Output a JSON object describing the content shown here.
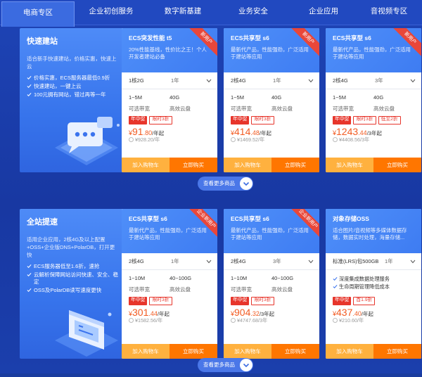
{
  "tabs": [
    "电商专区",
    "企业初创服务",
    "数字新基建",
    "业务安全",
    "企业应用",
    "音视频专区"
  ],
  "row1": {
    "promo": {
      "title": "快速建站",
      "desc": "适合新手快速建站，价格实惠，快速上云",
      "items": [
        "价格实惠，ECS服务器最低0.9折",
        "快速建站，一键上云",
        "100元拥有网站，错过再等一年"
      ]
    },
    "cards": [
      {
        "title": "ECS突发性能 t5",
        "desc": "20%性能基线，性价比之王！个人开发者建站必备",
        "ribbon": "新用户",
        "spec1": "1核2G",
        "spec2": "1年",
        "cpu": "1~5M",
        "cpu_sub": "可选带宽",
        "disk": "40G",
        "disk_sub": "高效云盘",
        "tag1": "年中促",
        "tag2": "限时3折",
        "currency": "¥",
        "price_int": "91",
        "price_dec": ".80",
        "unit": "/年起",
        "orig": "¥928.20/年",
        "btn_cart": "加入购物车",
        "btn_buy": "立即购买"
      },
      {
        "title": "ECS共享型 s6",
        "desc": "最新代产品，性能强劲，广泛适用于建站等应用",
        "ribbon": "新用户",
        "spec1": "2核4G",
        "spec2": "1年",
        "cpu": "1~5M",
        "cpu_sub": "可选带宽",
        "disk": "40G",
        "disk_sub": "高效云盘",
        "tag1": "年中促",
        "tag2": "限时3折",
        "currency": "¥",
        "price_int": "414",
        "price_dec": ".48",
        "unit": "/年起",
        "orig": "¥1469.52/年",
        "btn_cart": "加入购物车",
        "btn_buy": "立即购买"
      },
      {
        "title": "ECS共享型 s6",
        "desc": "最新代产品，性能强劲，广泛适用于建站等应用",
        "ribbon": "新用户",
        "spec1": "2核4G",
        "spec2": "3年",
        "cpu": "1~5M",
        "cpu_sub": "可选带宽",
        "disk": "40G",
        "disk_sub": "高效云盘",
        "tag1": "年中促",
        "tag2": "限时3折",
        "tag3": "低至2折",
        "currency": "¥",
        "price_int": "1243",
        "price_dec": ".44",
        "unit": "/3年起",
        "orig": "¥4408.56/3年",
        "btn_cart": "加入购物车",
        "btn_buy": "立即购买"
      }
    ],
    "more_label": "查看更多商品"
  },
  "row2": {
    "promo": {
      "title": "全站提速",
      "desc": "适用企业应用，2核4G及以上配置+OSS+企业版DNS+PolarDB，打开更快",
      "items": [
        "ECS服务器低至1.6折，速抢",
        "云解析保障网站访问快速、安全、稳定",
        "OSS及PolarDB读写速度更快"
      ]
    },
    "cards": [
      {
        "title": "ECS共享型 s6",
        "desc": "最新代产品，性能强劲，广泛适用于建站等应用",
        "ribbon": "企业新用户",
        "spec1": "2核4G",
        "spec2": "1年",
        "cpu": "1~10M",
        "cpu_sub": "可选带宽",
        "disk": "40~100G",
        "disk_sub": "高效云盘",
        "tag1": "年中促",
        "tag2": "限时3折",
        "currency": "¥",
        "price_int": "301",
        "price_dec": ".44",
        "unit": "/年起",
        "orig": "¥1582.56/年",
        "btn_cart": "加入购物车",
        "btn_buy": "立即购买"
      },
      {
        "title": "ECS共享型 s6",
        "desc": "最新代产品，性能强劲，广泛适用于建站等应用",
        "ribbon": "企业新用户",
        "spec1": "2核4G",
        "spec2": "3年",
        "cpu": "1~10M",
        "cpu_sub": "可选带宽",
        "disk": "40~100G",
        "disk_sub": "高效云盘",
        "tag1": "年中促",
        "tag2": "限时3折",
        "currency": "¥",
        "price_int": "904",
        "price_dec": ".32",
        "unit": "/3年起",
        "orig": "¥4747.68/3年",
        "btn_cart": "加入购物车",
        "btn_buy": "立即购买"
      },
      {
        "title": "对象存储OSS",
        "desc": "适合图片/音视频等多媒体数据存储，数据实时处理，海量存储...",
        "spec1": "标准(LRS)包500GB",
        "spec2": "1年",
        "check1": "深度集成数据处理服务",
        "check2": "生命周期管理降低成本",
        "tag1": "年中促",
        "tag2": "首1.9折",
        "currency": "¥",
        "price_int": "437",
        "price_dec": ".40",
        "unit": "/年起",
        "orig": "¥210.60/年",
        "btn_cart": "加入购物车",
        "btn_buy": "立即购买"
      }
    ],
    "more_label": "查看更多商品"
  },
  "colors": {
    "accent": "#ff7600",
    "price": "#f25b22",
    "tag": "#e7352b",
    "card_head": "#3e7cf2"
  }
}
